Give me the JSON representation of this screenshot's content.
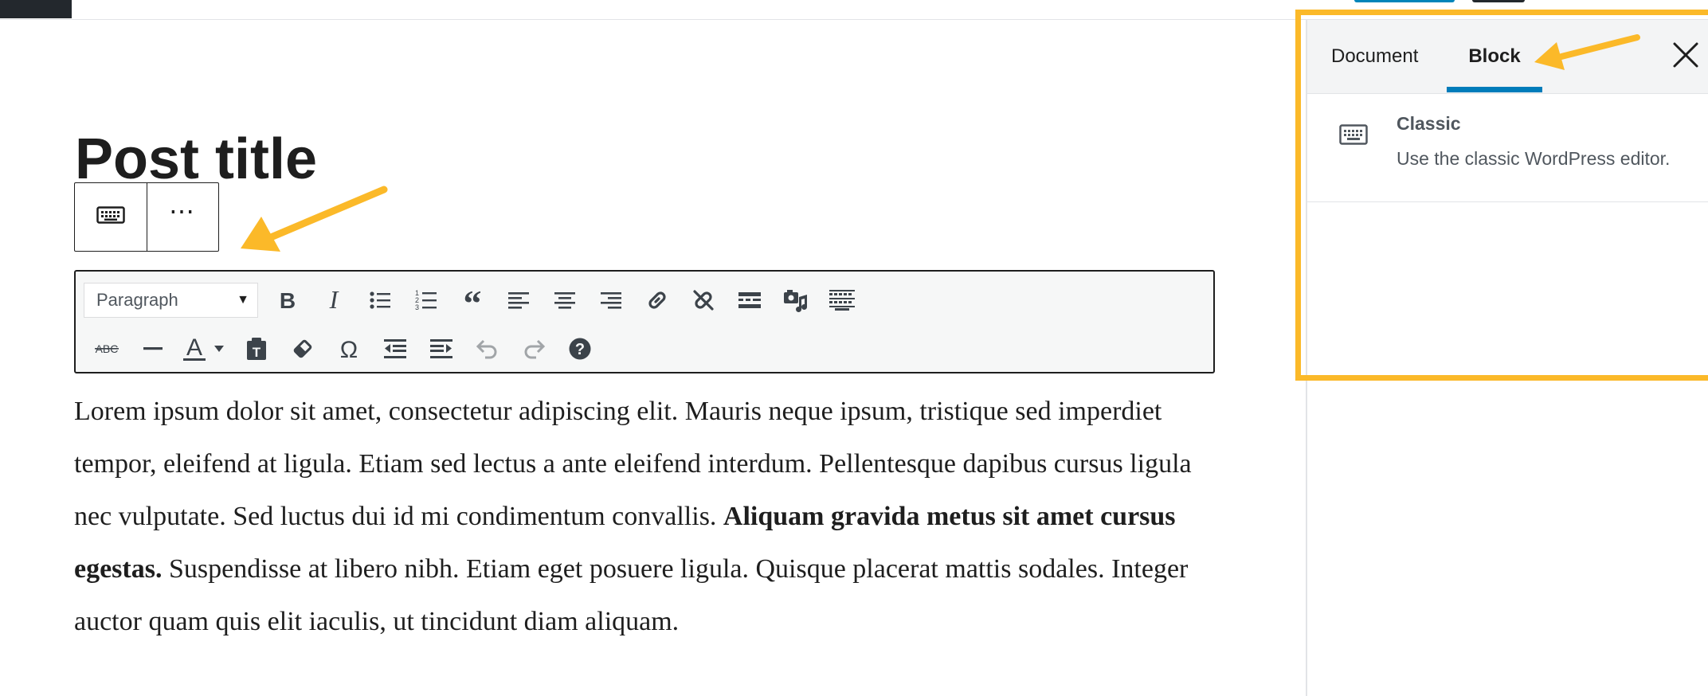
{
  "editor": {
    "post_title": "Post title",
    "block_toolbar": {
      "block_type_icon": "keyboard-icon",
      "more_options_label": "⋯"
    },
    "classic_toolbar": {
      "format_select_value": "Paragraph",
      "row1_icons": [
        "bold-icon",
        "italic-icon",
        "bulleted-list-icon",
        "numbered-list-icon",
        "blockquote-icon",
        "align-left-icon",
        "align-center-icon",
        "align-right-icon",
        "insert-link-icon",
        "remove-link-icon",
        "read-more-icon",
        "add-media-icon",
        "toolbar-toggle-icon"
      ],
      "row2_icons": [
        "strikethrough-icon",
        "horizontal-line-icon",
        "text-color-icon",
        "paste-as-text-icon",
        "clear-formatting-icon",
        "special-character-icon",
        "decrease-indent-icon",
        "increase-indent-icon",
        "undo-icon",
        "redo-icon",
        "help-icon"
      ],
      "strikethrough_glyph": "ABC",
      "text_color_glyph": "A"
    },
    "content": {
      "before_bold": "Lorem ipsum dolor sit amet, consectetur adipiscing elit. Mauris neque ipsum, tristique sed imperdiet tempor, eleifend at ligula. Etiam sed lectus a ante eleifend interdum. Pellentesque dapibus cursus ligula nec vulputate. Sed luctus dui id mi condimentum convallis. ",
      "bold": "Aliquam gravida metus sit amet cursus egestas.",
      "after_bold": " Suspendisse at libero nibh. Etiam eget posuere ligula. Quisque placerat mattis sodales. Integer auctor quam quis elit iaculis, ut tincidunt diam aliquam."
    }
  },
  "sidebar": {
    "tabs": [
      {
        "label": "Document",
        "active": false
      },
      {
        "label": "Block",
        "active": true
      }
    ],
    "close_icon": "close-icon",
    "block_card": {
      "icon": "keyboard-icon",
      "title": "Classic",
      "description": "Use the classic WordPress editor."
    }
  },
  "colors": {
    "annotation": "#fbb929",
    "active_tab_underline": "#007cba",
    "primary_button": "#0085ba"
  }
}
